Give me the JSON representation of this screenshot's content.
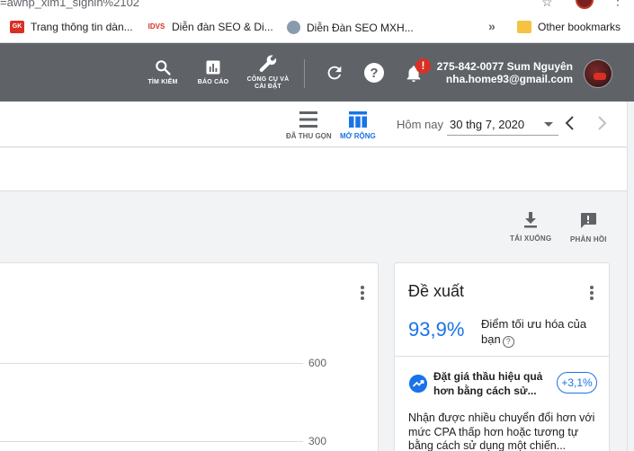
{
  "browser": {
    "url_fragment": "=awhp_xlm1_signin%2102",
    "bookmarks": [
      {
        "icon": "gk-favicon",
        "label": "Trang thông tin dàn..."
      },
      {
        "icon": "idvs-favicon",
        "label": "Diễn đàn SEO & Di..."
      },
      {
        "icon": "mxh-favicon",
        "label": "Diễn Đàn SEO MXH..."
      }
    ],
    "overflow_label": "»",
    "other_bookmarks": "Other bookmarks"
  },
  "header": {
    "tools": [
      {
        "icon": "search-icon",
        "label": "TÌM KIẾM"
      },
      {
        "icon": "bar-chart-icon",
        "label": "BÁO CÁO"
      },
      {
        "icon": "wrench-icon",
        "label_line1": "CÔNG CỤ VÀ",
        "label_line2": "CÀI ĐẶT"
      }
    ],
    "notification_count": "!",
    "account_id": "275-842-0077 Sum Nguyên",
    "account_email": "nha.home93@gmail.com"
  },
  "toolbar": {
    "collapse_label": "ĐÃ THU GỌN",
    "expand_label": "MỞ RỘNG",
    "date_prefix": "Hôm nay",
    "date_value": "30 thg 7, 2020"
  },
  "actions": {
    "download_label": "TẢI XUỐNG",
    "feedback_label": "PHẢN HỒI"
  },
  "chart": {
    "y_ticks": [
      "600",
      "300"
    ]
  },
  "recommendations": {
    "title": "Đề xuất",
    "score": "93,9%",
    "score_label": "Điểm tối ưu hóa của bạn",
    "item_title": "Đặt giá thầu hiệu quả hơn bằng cách sử...",
    "item_uplift": "+3,1%",
    "item_desc": "Nhận được nhiều chuyển đổi hơn với mức CPA thấp hơn hoặc tương tự bằng cách sử dụng một chiến..."
  },
  "colors": {
    "header_bg": "#5f6368",
    "accent": "#1a73e8",
    "badge": "#d93025"
  }
}
